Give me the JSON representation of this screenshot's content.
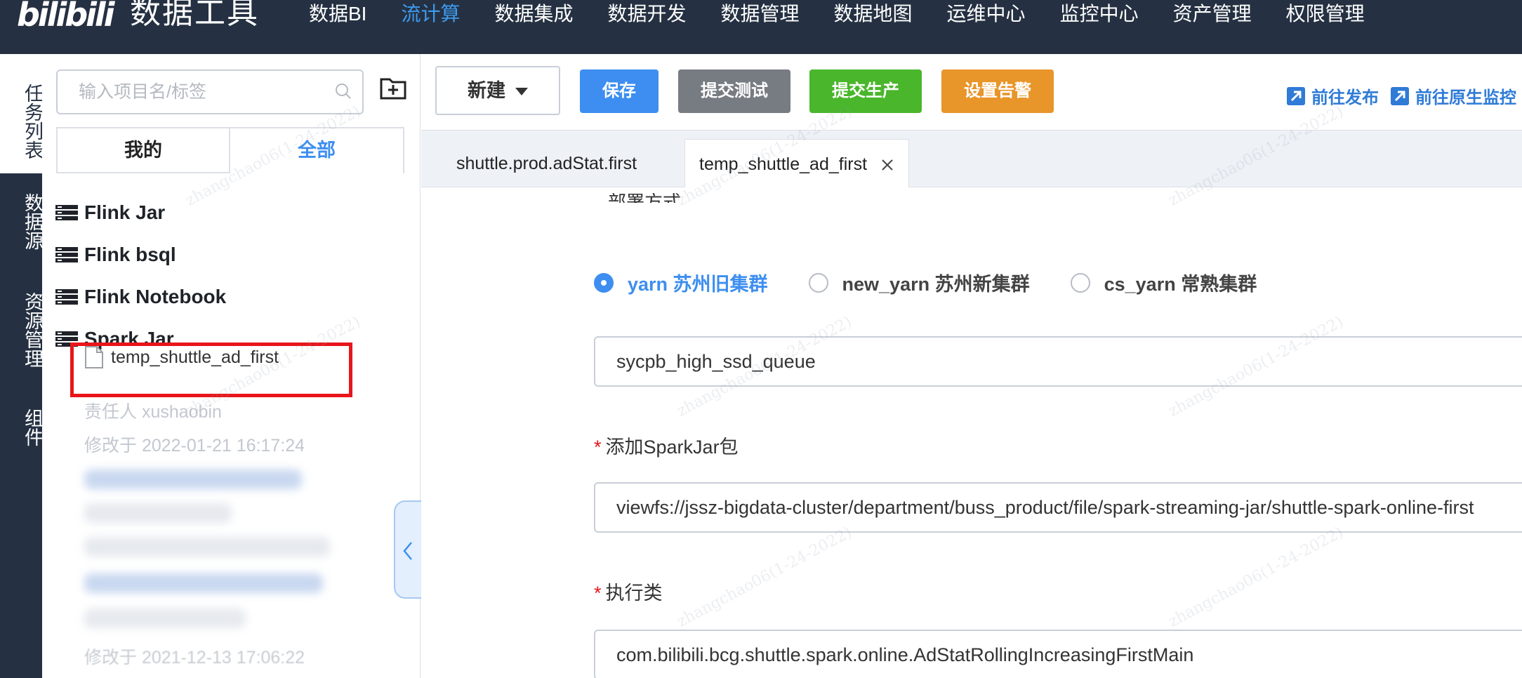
{
  "brand": {
    "logo_text": "bilibili",
    "app_title": "数据工具"
  },
  "nav": {
    "items": [
      "数据BI",
      "流计算",
      "数据集成",
      "数据开发",
      "数据管理",
      "数据地图",
      "运维中心",
      "监控中心",
      "资产管理",
      "权限管理"
    ],
    "active_index": 1
  },
  "rail": {
    "items": [
      "任务列表",
      "数据源",
      "资源管理",
      "组件"
    ],
    "active_index": 0
  },
  "sidebar": {
    "search_placeholder": "输入项目名/标签",
    "tabs": [
      "我的",
      "全部"
    ],
    "active_tab": 1,
    "folders": [
      "Flink Jar",
      "Flink bsql",
      "Flink Notebook",
      "Spark Jar"
    ],
    "selected_file": "temp_shuttle_ad_first",
    "owner_line": "责任人 xushaobin",
    "modified_line": "修改于 2022-01-21 16:17:24",
    "modified_line_2": "修改于 2021-12-13 17:06:22"
  },
  "toolbar": {
    "new_label": "新建",
    "save_label": "保存",
    "test_label": "提交测试",
    "prod_label": "提交生产",
    "alarm_label": "设置告警",
    "publish_link": "前往发布",
    "monitor_link": "前往原生监控"
  },
  "doc_tabs": [
    {
      "label": "shuttle.prod.adStat.first",
      "active": false
    },
    {
      "label": "temp_shuttle_ad_first",
      "active": true
    }
  ],
  "form": {
    "cut_label": "部署方式",
    "clusters": [
      {
        "label": "yarn 苏州旧集群",
        "checked": true
      },
      {
        "label": "new_yarn 苏州新集群",
        "checked": false
      },
      {
        "label": "cs_yarn 常熟集群",
        "checked": false
      }
    ],
    "queue_value": "sycpb_high_ssd_queue",
    "jar_label": "添加SparkJar包",
    "jar_value": "viewfs://jssz-bigdata-cluster/department/buss_product/file/spark-streaming-jar/shuttle-spark-online-first",
    "main_class_label": "执行类",
    "main_class_value": "com.bilibili.bcg.shuttle.spark.online.AdStatRollingIncreasingFirstMain",
    "required_mark": "*"
  },
  "watermark_text": "zhangchao06(1-24-2022)",
  "colors": {
    "nav_bg": "#253142",
    "accent": "#3d8ef0",
    "save": "#3d8ef0",
    "test": "#777b82",
    "prod": "#4ab62b",
    "alarm": "#e8952a",
    "highlight": "#e8151b"
  }
}
